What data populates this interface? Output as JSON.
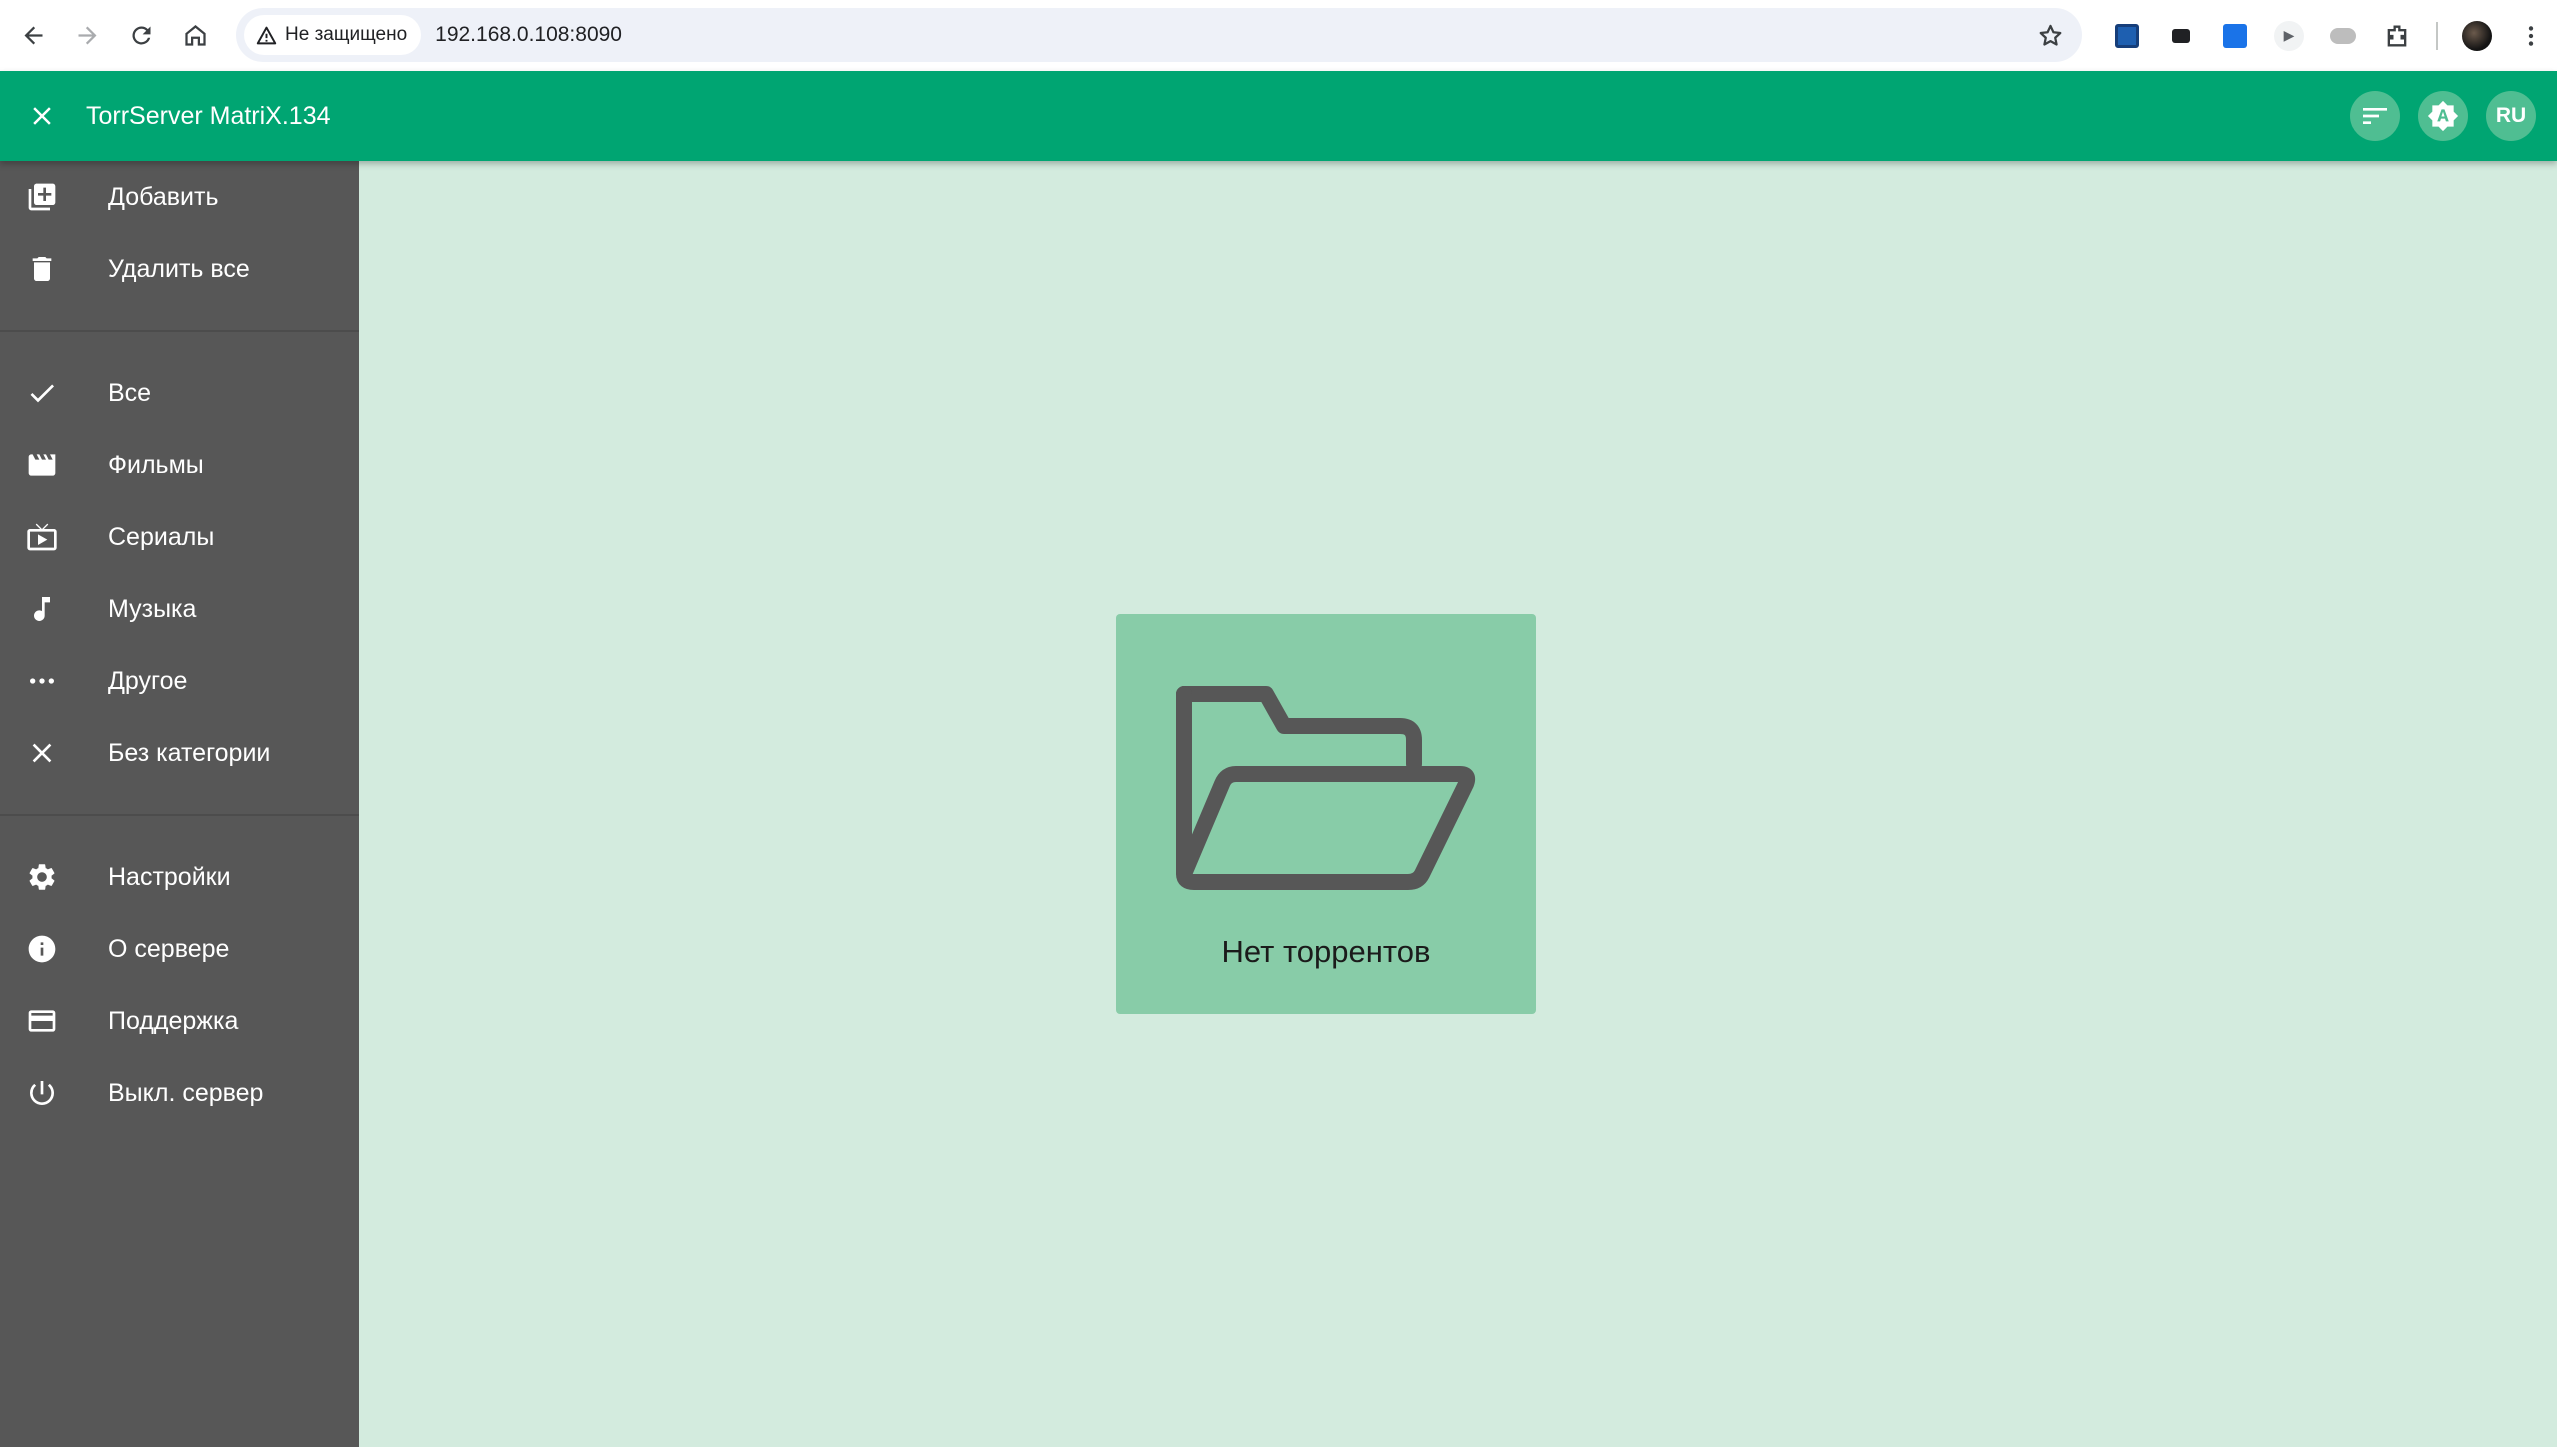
{
  "browser": {
    "security_label": "Не защищено",
    "url": "192.168.0.108:8090",
    "icons": [
      "back-icon",
      "forward-icon",
      "reload-icon",
      "home-icon",
      "warning-icon",
      "star-icon",
      "extensions-icon",
      "menu-kebab-icon"
    ]
  },
  "app_bar": {
    "title": "TorrServer MatriX.134",
    "lang": "RU",
    "color": "#00a572",
    "icons": [
      "close-icon",
      "sort-icon",
      "brightness-auto-icon"
    ]
  },
  "sidebar": {
    "background": "#575757",
    "groups": [
      [
        {
          "label": "Добавить",
          "icon": "library-add-icon"
        },
        {
          "label": "Удалить все",
          "icon": "delete-icon"
        }
      ],
      [
        {
          "label": "Все",
          "icon": "check-icon"
        },
        {
          "label": "Фильмы",
          "icon": "movie-icon"
        },
        {
          "label": "Сериалы",
          "icon": "live-tv-icon"
        },
        {
          "label": "Музыка",
          "icon": "music-note-icon"
        },
        {
          "label": "Другое",
          "icon": "more-horiz-icon"
        },
        {
          "label": "Без категории",
          "icon": "close-icon"
        }
      ],
      [
        {
          "label": "Настройки",
          "icon": "settings-icon"
        },
        {
          "label": "О сервере",
          "icon": "info-icon"
        },
        {
          "label": "Поддержка",
          "icon": "credit-card-icon"
        },
        {
          "label": "Выкл. сервер",
          "icon": "power-icon"
        }
      ]
    ]
  },
  "main": {
    "empty_text": "Нет торрентов",
    "empty_icon": "folder-open-icon",
    "background": "#d3ebde",
    "card_color": "#88cca8"
  }
}
